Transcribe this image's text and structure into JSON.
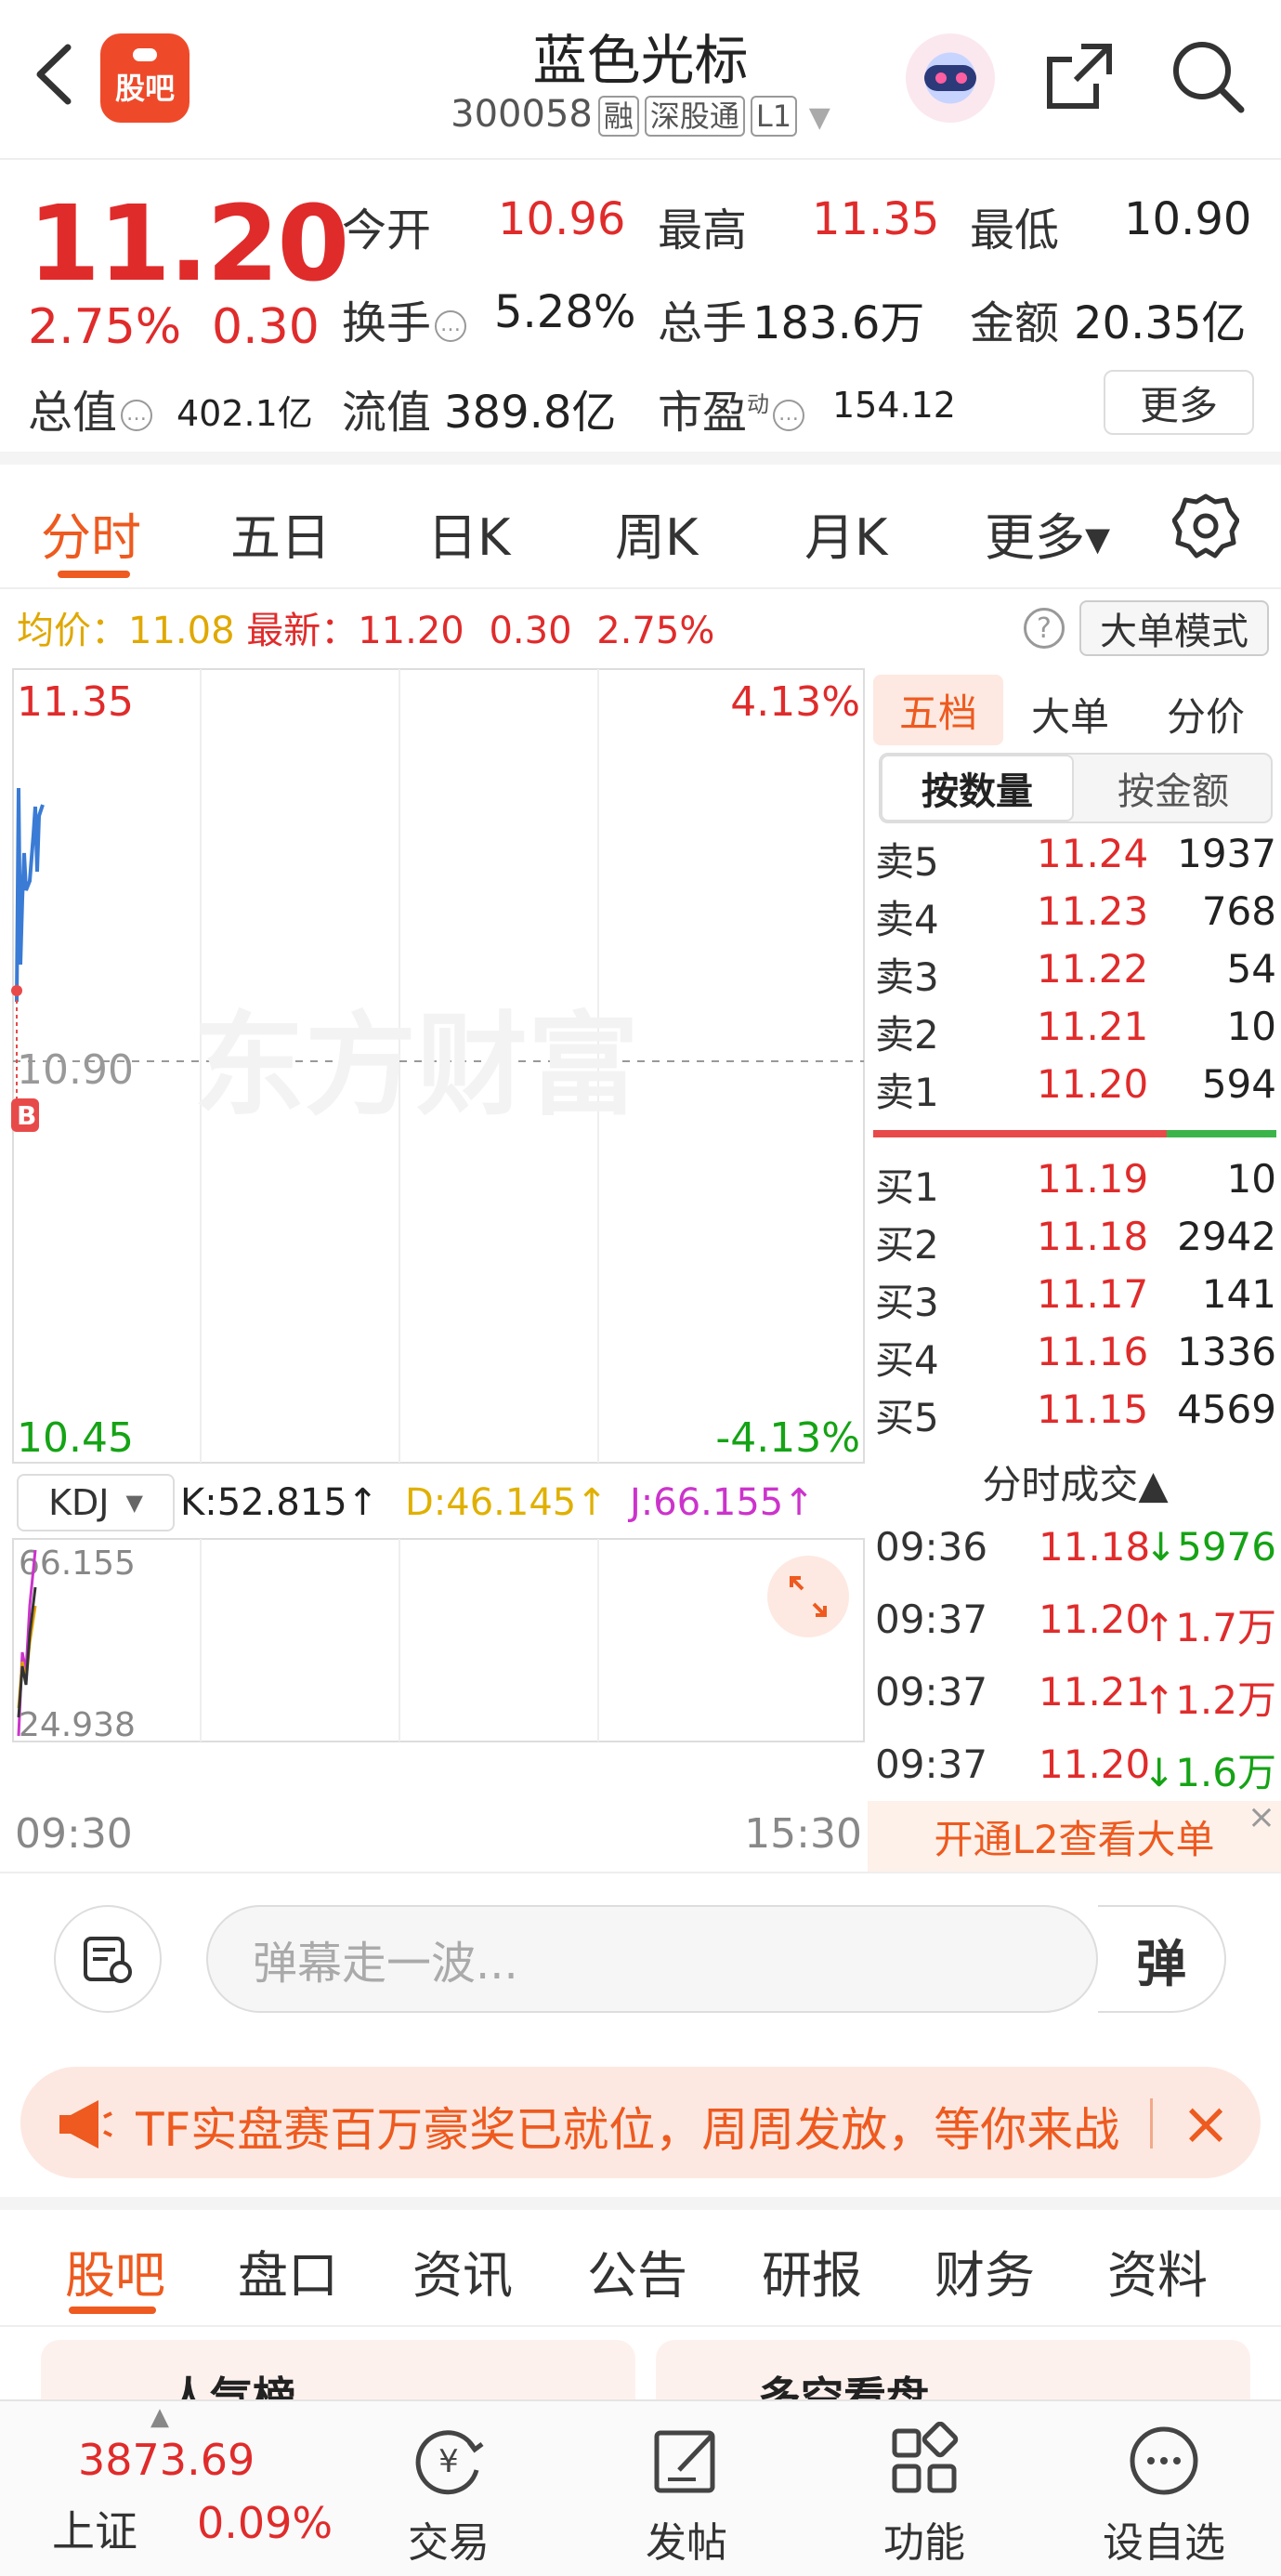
{
  "header": {
    "back_icon": "chevron-left-icon",
    "logo_text": "股吧",
    "stock_name": "蓝色光标",
    "stock_code": "300058",
    "tags": [
      "融",
      "深股通",
      "L1"
    ]
  },
  "quote": {
    "price": "11.20",
    "change_pct": "2.75%",
    "change_amt": "0.30",
    "open_label": "今开",
    "open": "10.96",
    "high_label": "最高",
    "high": "11.35",
    "low_label": "最低",
    "low": "10.90",
    "turnover_label": "换手",
    "turnover": "5.28%",
    "volume_label": "总手",
    "volume": "183.6万",
    "amount_label": "金额",
    "amount": "20.35亿",
    "mcap_label": "总值",
    "mcap": "402.1亿",
    "float_label": "流值",
    "float_cap": "389.8亿",
    "pe_label": "市盈",
    "pe_sup": "动",
    "pe": "154.12",
    "more_button": "更多"
  },
  "tabs": [
    "分时",
    "五日",
    "日K",
    "周K",
    "月K",
    "更多▾"
  ],
  "info_line": {
    "avg_label": "均价：",
    "avg": "11.08",
    "latest_label": "最新：",
    "latest": "11.20",
    "latest_chg": "0.30",
    "latest_pct": "2.75%",
    "big_order_mode": "大单模式"
  },
  "chart": {
    "y_top": "11.35",
    "y_mid": "10.90",
    "y_bot": "10.45",
    "pct_top": "4.13%",
    "pct_bot": "-4.13%",
    "watermark": "东方财富",
    "marker": "B",
    "x_start": "09:30",
    "x_end": "15:30",
    "kdj_select": "KDJ",
    "k": "K:52.815↑",
    "d": "D:46.145↑",
    "j": "J:66.155↑",
    "kdj_top": "66.155",
    "kdj_bot": "24.938",
    "colors": {
      "up": "#e02b2b",
      "down": "#15a315",
      "line": "#3a7bd5",
      "accent": "#ee5a1f"
    }
  },
  "orderbook": {
    "tabs": [
      "五档",
      "大单",
      "分价"
    ],
    "toggle": [
      "按数量",
      "按金额"
    ],
    "asks": [
      {
        "label": "卖5",
        "price": "11.24",
        "vol": "1937"
      },
      {
        "label": "卖4",
        "price": "11.23",
        "vol": "768"
      },
      {
        "label": "卖3",
        "price": "11.22",
        "vol": "54"
      },
      {
        "label": "卖2",
        "price": "11.21",
        "vol": "10"
      },
      {
        "label": "卖1",
        "price": "11.20",
        "vol": "594"
      }
    ],
    "bids": [
      {
        "label": "买1",
        "price": "11.19",
        "vol": "10"
      },
      {
        "label": "买2",
        "price": "11.18",
        "vol": "2942"
      },
      {
        "label": "买3",
        "price": "11.17",
        "vol": "141"
      },
      {
        "label": "买4",
        "price": "11.16",
        "vol": "1336"
      },
      {
        "label": "买5",
        "price": "11.15",
        "vol": "4569"
      }
    ],
    "ticks_header": "分时成交▲",
    "ticks": [
      {
        "time": "09:36",
        "price": "11.18",
        "vol": "↓5976",
        "dir": "down"
      },
      {
        "time": "09:37",
        "price": "11.20",
        "vol": "↑1.7万",
        "dir": "up"
      },
      {
        "time": "09:37",
        "price": "11.21",
        "vol": "↑1.2万",
        "dir": "up"
      },
      {
        "time": "09:37",
        "price": "11.20",
        "vol": "↓1.6万",
        "dir": "down"
      }
    ],
    "l2_banner": "开通L2查看大单"
  },
  "danmaku": {
    "placeholder": "弹幕走一波...",
    "send": "弹"
  },
  "promo": {
    "text": "TF实盘赛百万豪奖已就位，周周发放，等你来战"
  },
  "bottom_tabs": [
    "股吧",
    "盘口",
    "资讯",
    "公告",
    "研报",
    "财务",
    "资料"
  ],
  "cards": [
    "人气榜",
    "多空看盘"
  ],
  "footer": {
    "index_value": "3873.69",
    "index_name": "上证",
    "index_pct": "0.09%",
    "buttons": [
      "交易",
      "发帖",
      "功能",
      "设自选"
    ]
  }
}
